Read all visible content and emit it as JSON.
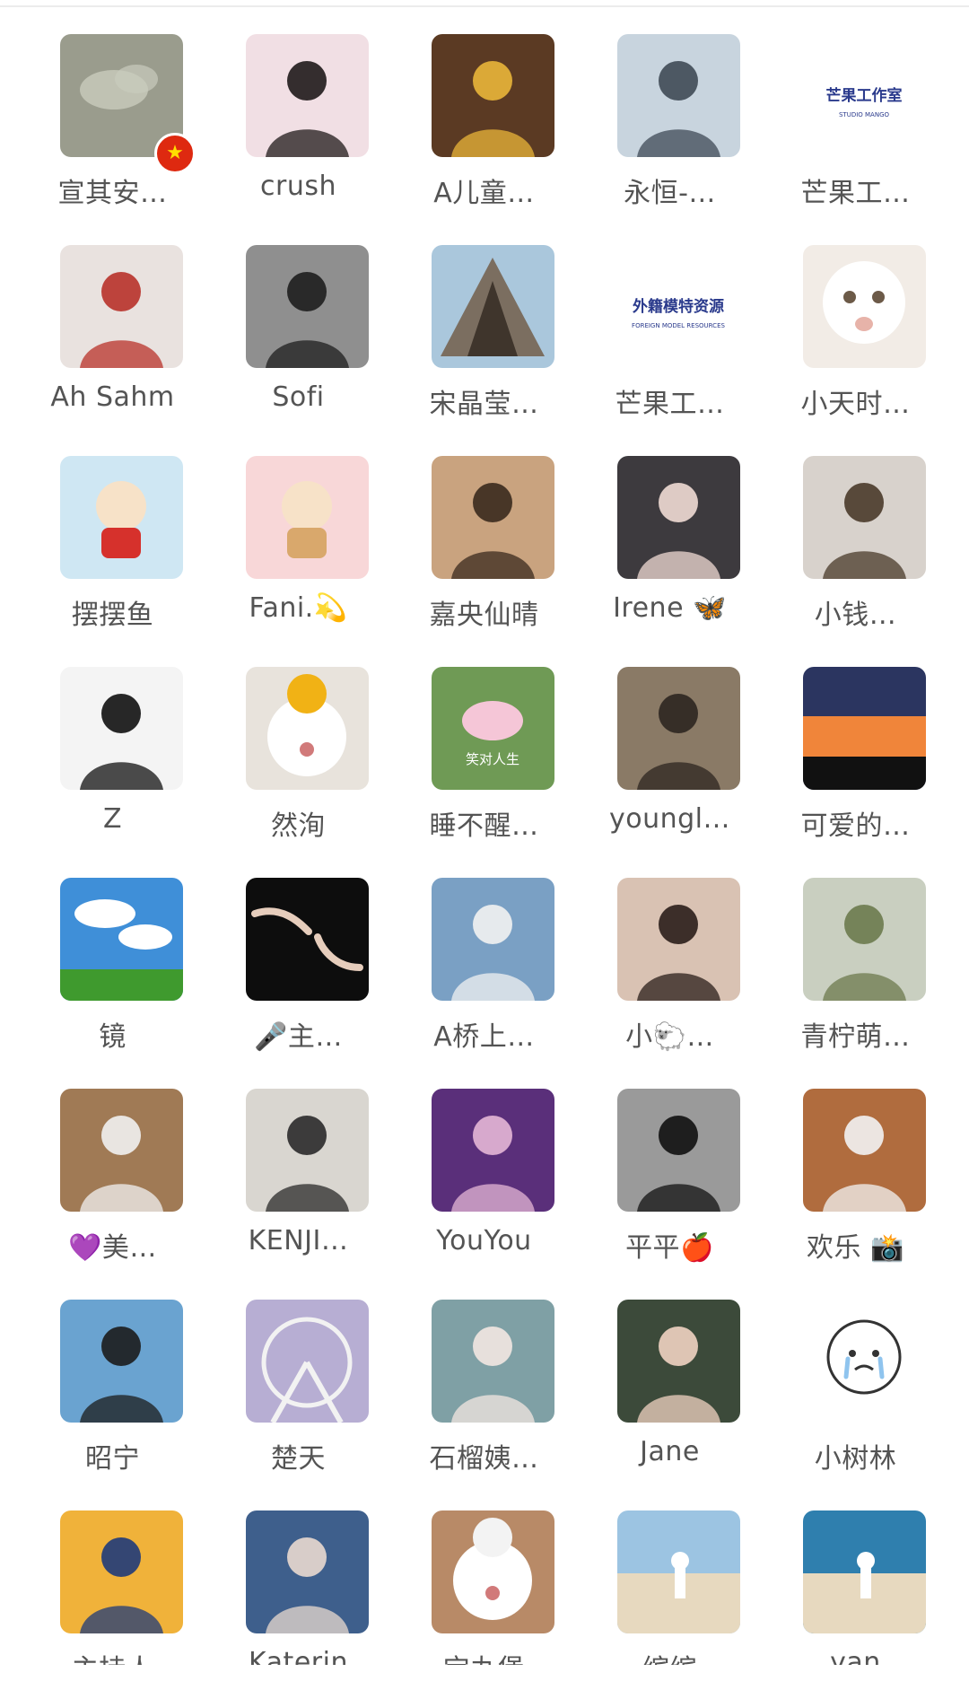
{
  "members": [
    {
      "name": "宣其安…",
      "bg": "#9a9c8d",
      "fg": "#c9ccbd",
      "icon": "cloud-photo"
    },
    {
      "name": "crush",
      "bg": "#f1dfe4",
      "fg": "#1f1a1a",
      "icon": "person-photo"
    },
    {
      "name": "A儿童…",
      "bg": "#5b3a23",
      "fg": "#e9b63a",
      "icon": "person-photo"
    },
    {
      "name": "永恒-…",
      "bg": "#c8d4de",
      "fg": "#3f4a55",
      "icon": "person-photo"
    },
    {
      "name": "芒果工…",
      "bg": "#ffffff",
      "fg": "#2a3a8c",
      "icon": "logo-photo",
      "logo_text": "芒果工作室",
      "logo_sub": "STUDIO MANGO"
    },
    {
      "name": "Ah Sahm",
      "bg": "#e9e2df",
      "fg": "#b8322a",
      "icon": "person-photo"
    },
    {
      "name": "Sofi",
      "bg": "#8f8f8f",
      "fg": "#1e1e1e",
      "icon": "person-photo"
    },
    {
      "name": "宋晶莹…",
      "bg": "#aac7dc",
      "fg": "#7b6e60",
      "icon": "tent-photo"
    },
    {
      "name": "芒果工…",
      "bg": "#ffffff",
      "fg": "#2a3a8c",
      "icon": "logo-photo",
      "logo_text": "外籍模特资源",
      "logo_sub": "FOREIGN MODEL RESOURCES"
    },
    {
      "name": "小天时…",
      "bg": "#f2ece6",
      "fg": "#e7b3a9",
      "icon": "cat-photo"
    },
    {
      "name": "摆摆鱼",
      "bg": "#cfe7f3",
      "fg": "#d6312c",
      "icon": "cartoon-photo"
    },
    {
      "name": "Fani.💫",
      "bg": "#f8d7d8",
      "fg": "#d9a86c",
      "icon": "cartoon-photo"
    },
    {
      "name": "嘉央仙晴",
      "bg": "#c9a37f",
      "fg": "#3a2a1e",
      "icon": "person-photo"
    },
    {
      "name": "Irene 🦋",
      "bg": "#3d3a3e",
      "fg": "#f0dbd4",
      "icon": "person-photo"
    },
    {
      "name": "小钱…",
      "bg": "#d8d2cc",
      "fg": "#4a3a2a",
      "icon": "person-photo"
    },
    {
      "name": "Z",
      "bg": "#f4f4f4",
      "fg": "#111111",
      "icon": "person-photo"
    },
    {
      "name": "然洵",
      "bg": "#e8e3dc",
      "fg": "#f1b215",
      "icon": "dog-photo"
    },
    {
      "name": "睡不醒…",
      "bg": "#6f9a55",
      "fg": "#f5c6d7",
      "icon": "lotus-photo",
      "caption": "笑对人生"
    },
    {
      "name": "youngl…",
      "bg": "#8a7a66",
      "fg": "#2c2620",
      "icon": "person-photo"
    },
    {
      "name": "可爱的…",
      "bg": "#2b3560",
      "fg": "#f0853a",
      "icon": "sunset-photo"
    },
    {
      "name": "镜",
      "bg": "#3f8fd8",
      "fg": "#ffffff",
      "icon": "sky-photo"
    },
    {
      "name": "🎤主…",
      "bg": "#0d0d0d",
      "fg": "#e6cdbc",
      "icon": "hands-photo"
    },
    {
      "name": "A桥上…",
      "bg": "#7aa0c4",
      "fg": "#f2f2f2",
      "icon": "person-photo"
    },
    {
      "name": "小🐑…",
      "bg": "#d9c2b3",
      "fg": "#2a1e1a",
      "icon": "person-photo"
    },
    {
      "name": "青柠萌…",
      "bg": "#c9cfc0",
      "fg": "#6c7a4e",
      "icon": "person-photo"
    },
    {
      "name": "💜美…",
      "bg": "#a07a55",
      "fg": "#f1f1f1",
      "icon": "person-photo"
    },
    {
      "name": "KENJI…",
      "bg": "#d9d6d0",
      "fg": "#2a2a2a",
      "icon": "person-photo"
    },
    {
      "name": "YouYou",
      "bg": "#5a2f7a",
      "fg": "#e4b7d6",
      "icon": "person-photo"
    },
    {
      "name": "平平🍎",
      "bg": "#9a9a9a",
      "fg": "#111111",
      "icon": "person-photo"
    },
    {
      "name": "欢乐 📸",
      "bg": "#b06c3e",
      "fg": "#f3f3f3",
      "icon": "person-photo"
    },
    {
      "name": "昭宁",
      "bg": "#6aa3d0",
      "fg": "#1c1c1c",
      "icon": "person-photo"
    },
    {
      "name": "楚天",
      "bg": "#b7aed3",
      "fg": "#f2f2f2",
      "icon": "wheel-photo"
    },
    {
      "name": "石榴姨…",
      "bg": "#7fa0a5",
      "fg": "#f3e7e2",
      "icon": "person-photo"
    },
    {
      "name": "Jane",
      "bg": "#3c4a3a",
      "fg": "#f0d3c2",
      "icon": "person-photo"
    },
    {
      "name": "小树林",
      "bg": "#ffffff",
      "fg": "#333333",
      "icon": "crying-face-sticker"
    },
    {
      "name": "",
      "bg": "#f0b23a",
      "fg": "#1f3a7a",
      "icon": "person-photo"
    },
    {
      "name": "",
      "bg": "#3e5f8c",
      "fg": "#e9d9cf",
      "icon": "person-photo"
    },
    {
      "name": "",
      "bg": "#b88a67",
      "fg": "#f3f3f3",
      "icon": "dog-photo"
    },
    {
      "name": "",
      "bg": "#9cc4e2",
      "fg": "#ffffff",
      "icon": "beach-photo"
    },
    {
      "name": "",
      "bg": "#2f7fae",
      "fg": "#ffffff",
      "icon": "beach-photo"
    }
  ],
  "partial_labels": [
    "主持人",
    "Katerin",
    "宝丸堡",
    "缤缤",
    "yan"
  ],
  "badges": {
    "flag": {
      "glyph": "★",
      "color": "#de2910"
    }
  }
}
